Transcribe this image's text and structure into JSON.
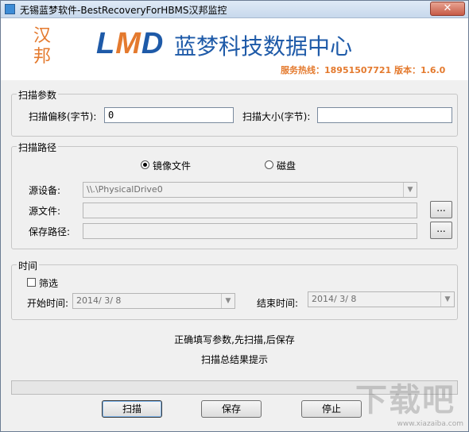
{
  "window": {
    "title": "无锡蓝梦软件-BestRecoveryForHBMS汉邦监控",
    "close_label": "✕"
  },
  "header": {
    "logo_chars": "汉邦",
    "brand_l": "L",
    "brand_m": "M",
    "brand_d": "D",
    "company": "蓝梦科技数据中心",
    "hotline": "服务热线：18951507721 版本：1.6.0"
  },
  "scan_params": {
    "legend": "扫描参数",
    "offset_label": "扫描偏移(字节):",
    "offset_value": "0",
    "size_label": "扫描大小(字节):",
    "size_value": ""
  },
  "scan_path": {
    "legend": "扫描路径",
    "radio_image": "镜像文件",
    "radio_disk": "磁盘",
    "selected": "镜像文件",
    "source_device_label": "源设备:",
    "source_device_value": "\\\\.\\PhysicalDrive0",
    "source_file_label": "源文件:",
    "source_file_value": "",
    "save_path_label": "保存路径:",
    "save_path_value": "",
    "browse_label": "..."
  },
  "time": {
    "legend": "时间",
    "filter_label": "筛选",
    "filter_checked": false,
    "start_label": "开始时间:",
    "start_value": "2014/ 3/ 8",
    "end_label": "结束时间:",
    "end_value": "2014/ 3/ 8"
  },
  "status": {
    "instruction": "正确填写参数,先扫描,后保存",
    "result": "扫描总结果提示",
    "progress": 0
  },
  "buttons": {
    "scan": "扫描",
    "save": "保存",
    "stop": "停止"
  },
  "watermark": {
    "text": "下载吧",
    "url": "www.xiazaiba.com"
  },
  "colors": {
    "brand_blue": "#1e5aa8",
    "brand_orange": "#e47a2e"
  },
  "icons": {
    "app": "app-icon",
    "close": "close-icon",
    "dropdown": "chevron-down-icon"
  }
}
